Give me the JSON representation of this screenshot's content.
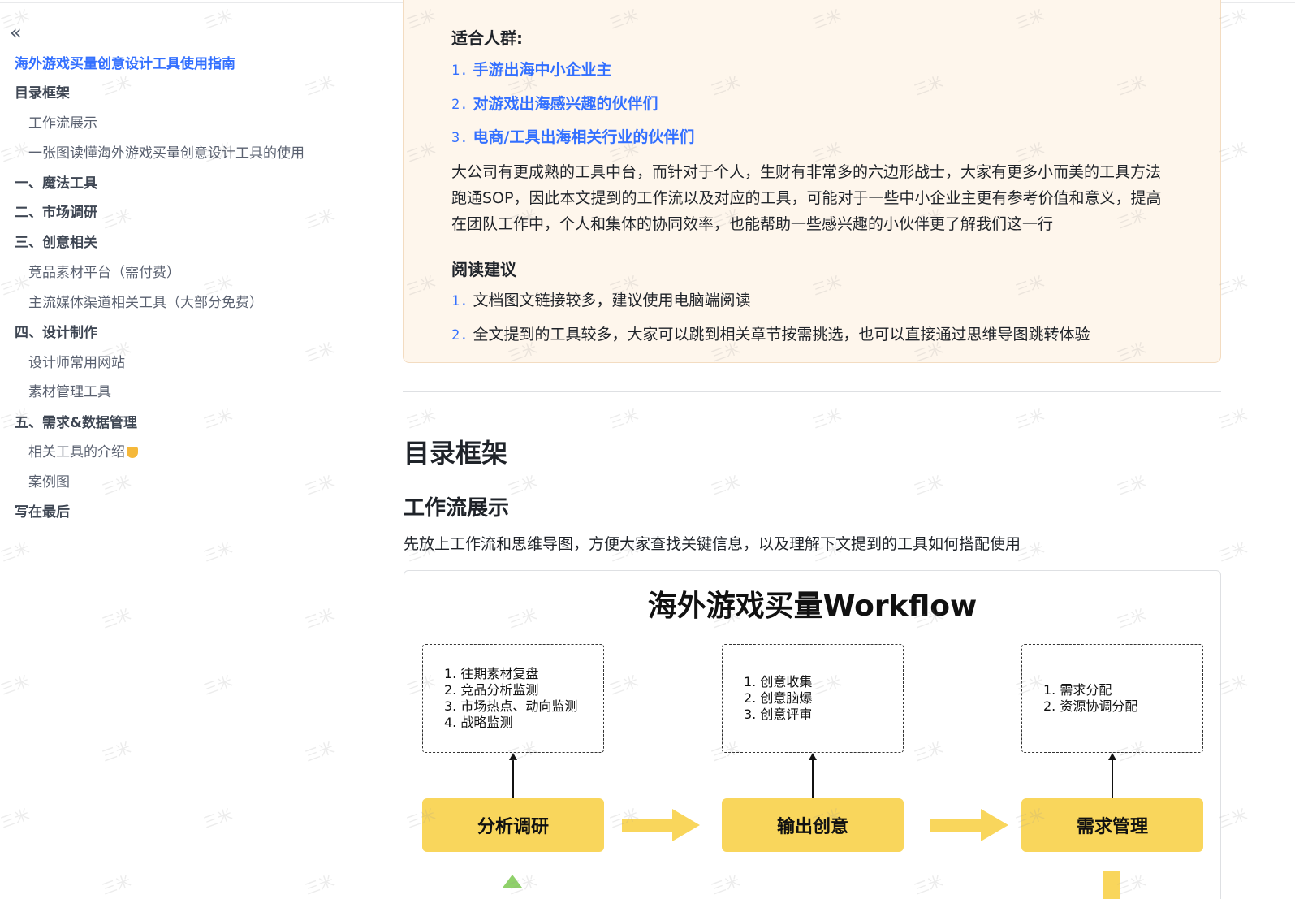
{
  "sidebar": {
    "collapse_icon": "«",
    "items": [
      {
        "label": "海外游戏买量创意设计工具使用指南",
        "level": "title",
        "active": true
      },
      {
        "label": "目录框架",
        "level": "h1"
      },
      {
        "label": "工作流展示",
        "level": "h2"
      },
      {
        "label": "一张图读懂海外游戏买量创意设计工具的使用",
        "level": "h2"
      },
      {
        "label": "一、魔法工具",
        "level": "h1"
      },
      {
        "label": "二、市场调研",
        "level": "h1"
      },
      {
        "label": "三、创意相关",
        "level": "h1"
      },
      {
        "label": "竞品素材平台（需付费）",
        "level": "h2"
      },
      {
        "label": "主流媒体渠道相关工具（大部分免费）",
        "level": "h2"
      },
      {
        "label": "四、设计制作",
        "level": "h1"
      },
      {
        "label": "设计师常用网站",
        "level": "h2"
      },
      {
        "label": "素材管理工具",
        "level": "h2"
      },
      {
        "label": "五、需求&数据管理",
        "level": "h1"
      },
      {
        "label": "相关工具的介绍",
        "level": "h2",
        "emoji": "pointing-down-hand-icon"
      },
      {
        "label": "案例图",
        "level": "h2"
      },
      {
        "label": "写在最后",
        "level": "h1"
      }
    ]
  },
  "callout": {
    "audience_heading": "适合人群:",
    "audience": [
      {
        "num": "1.",
        "text": "手游出海中小企业主"
      },
      {
        "num": "2.",
        "text": "对游戏出海感兴趣的伙伴们"
      },
      {
        "num": "3.",
        "text": "电商/工具出海相关行业的伙伴们"
      }
    ],
    "paragraph_lines": [
      "大公司有更成熟的工具中台，而针对于个人，生财有非常多的六边形战士，大家有更多小而美的工具方法",
      "跑通SOP，因此本文提到的工作流以及对应的工具，可能对于一些中小企业主更有参考价值和意义，提高",
      "在团队工作中，个人和集体的协同效率，也能帮助一些感兴趣的小伙伴更了解我们这一行"
    ],
    "reading_heading": "阅读建议",
    "reading": [
      {
        "num": "1.",
        "text": "文档图文链接较多，建议使用电脑端阅读"
      },
      {
        "num": "2.",
        "text": "全文提到的工具较多，大家可以跳到相关章节按需挑选，也可以直接通过思维导图跳转体验"
      }
    ]
  },
  "main": {
    "section_title": "目录框架",
    "subsection_title": "工作流展示",
    "intro": "先放上工作流和思维导图，方便大家查找关键信息，以及理解下文提到的工具如何搭配使用"
  },
  "workflow": {
    "title": "海外游戏买量Workflow",
    "stages": [
      {
        "name": "分析调研",
        "tasks": [
          "1. 往期素材复盘",
          "2. 竞品分析监测",
          "3. 市场热点、动向监测",
          "4. 战略监测"
        ]
      },
      {
        "name": "输出创意",
        "tasks": [
          "1. 创意收集",
          "2. 创意脑爆",
          "3. 创意评审"
        ]
      },
      {
        "name": "需求管理",
        "tasks": [
          "1. 需求分配",
          "2. 资源协调分配"
        ]
      }
    ],
    "colors": {
      "stage_fill": "#f9d65c",
      "accent_green": "#8fd16a"
    }
  },
  "watermark": "三米",
  "theme": {
    "link_color": "#3370ff",
    "callout_bg": "#fef6ec"
  }
}
